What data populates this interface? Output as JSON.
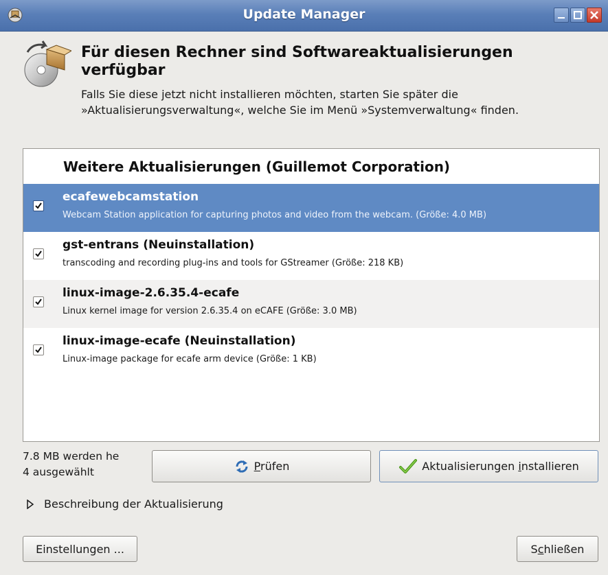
{
  "window": {
    "title": "Update Manager",
    "colors": {
      "titlebar": "#5a7fb8",
      "selection": "#5f8ac4",
      "background": "#ecebe8"
    }
  },
  "header": {
    "icon": "package-update-icon",
    "title": "Für diesen Rechner sind Softwareaktualisierungen verfügbar",
    "description": "Falls Sie diese jetzt nicht installieren möchten, starten Sie später die »Aktualisierungsverwaltung«, welche Sie im Menü »Systemverwaltung« finden."
  },
  "list": {
    "group_title": "Weitere Aktualisierungen (Guillemot Corporation)",
    "items": [
      {
        "name": "ecafewebcamstation",
        "description": "Webcam Station application for capturing photos and video from the webcam. (Größe: 4.0 MB)",
        "checked": true,
        "selected": true
      },
      {
        "name": "gst-entrans (Neuinstallation)",
        "description": "transcoding and recording plug-ins and tools for GStreamer (Größe: 218 KB)",
        "checked": true,
        "selected": false
      },
      {
        "name": "linux-image-2.6.35.4-ecafe",
        "description": "Linux kernel image for version 2.6.35.4 on eCAFE (Größe: 3.0 MB)",
        "checked": true,
        "selected": false
      },
      {
        "name": "linux-image-ecafe (Neuinstallation)",
        "description": "Linux-image package for ecafe arm device (Größe: 1 KB)",
        "checked": true,
        "selected": false
      }
    ]
  },
  "status": {
    "download_size": "7.8 MB werden he",
    "selected_count": "4 ausgewählt"
  },
  "buttons": {
    "check": {
      "mnemonic": "P",
      "rest": "rüfen",
      "icon": "refresh-icon"
    },
    "install": {
      "before": "Aktualisierungen ",
      "mnemonic": "i",
      "rest": "nstallieren",
      "icon": "checkmark-icon"
    },
    "settings": "Einstellungen ...",
    "close": {
      "before": "S",
      "mnemonic": "c",
      "rest": "hließen"
    }
  },
  "expander": {
    "label": "Beschreibung der Aktualisierung",
    "expanded": false
  }
}
